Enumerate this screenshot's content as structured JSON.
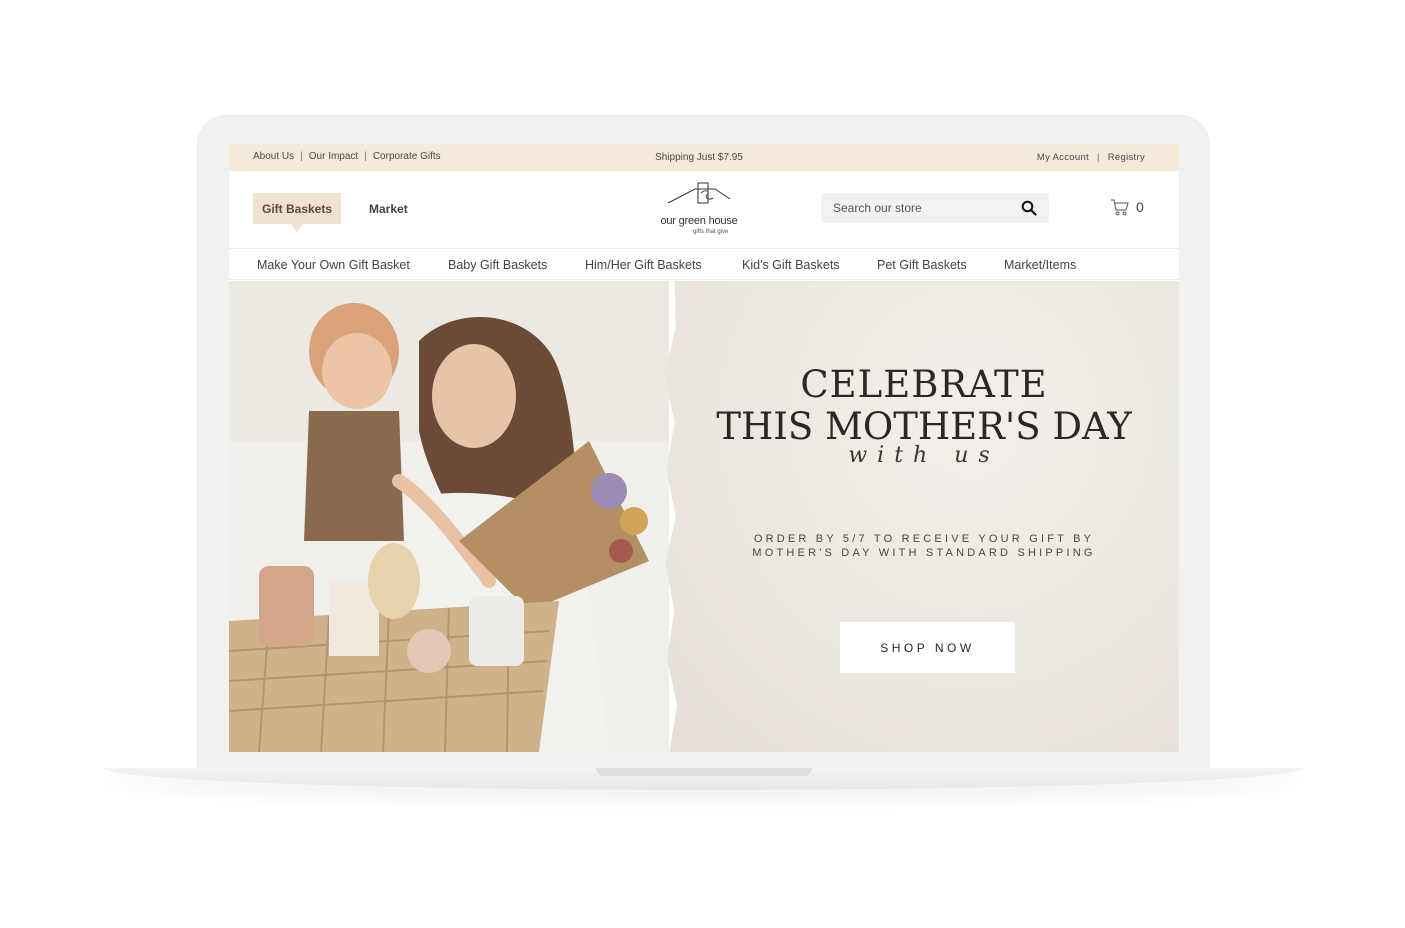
{
  "utility": {
    "links_left": [
      "About Us",
      "Our Impact",
      "Corporate Gifts"
    ],
    "separator": "|",
    "shipping": "Shipping Just $7.95",
    "links_right": [
      "My Account",
      "Registry"
    ]
  },
  "header": {
    "tabs": [
      "Gift Baskets",
      "Market"
    ],
    "logo_name": "our green house",
    "logo_tagline": "gifts that give",
    "search_placeholder": "Search our store",
    "cart_count": "0"
  },
  "nav": {
    "items": [
      "Make Your Own Gift Basket",
      "Baby Gift Baskets",
      "Him/Her Gift Baskets",
      "Kid's Gift Baskets",
      "Pet Gift Baskets",
      "Market/Items"
    ]
  },
  "hero": {
    "title_line1": "CELEBRATE",
    "title_line2": "THIS MOTHER'S DAY",
    "script": "with us",
    "order_line1": "ORDER BY 5/7 TO RECEIVE YOUR GIFT BY",
    "order_line2": "MOTHER'S DAY WITH STANDARD SHIPPING",
    "button": "SHOP NOW"
  },
  "colors": {
    "utility_bar": "#f3ead9",
    "tab_active": "#efe2d0",
    "hero_paper": "#ebe6df",
    "text_dark": "#2b2724"
  },
  "icons": [
    "search-icon",
    "cart-icon",
    "house-logo-icon"
  ]
}
